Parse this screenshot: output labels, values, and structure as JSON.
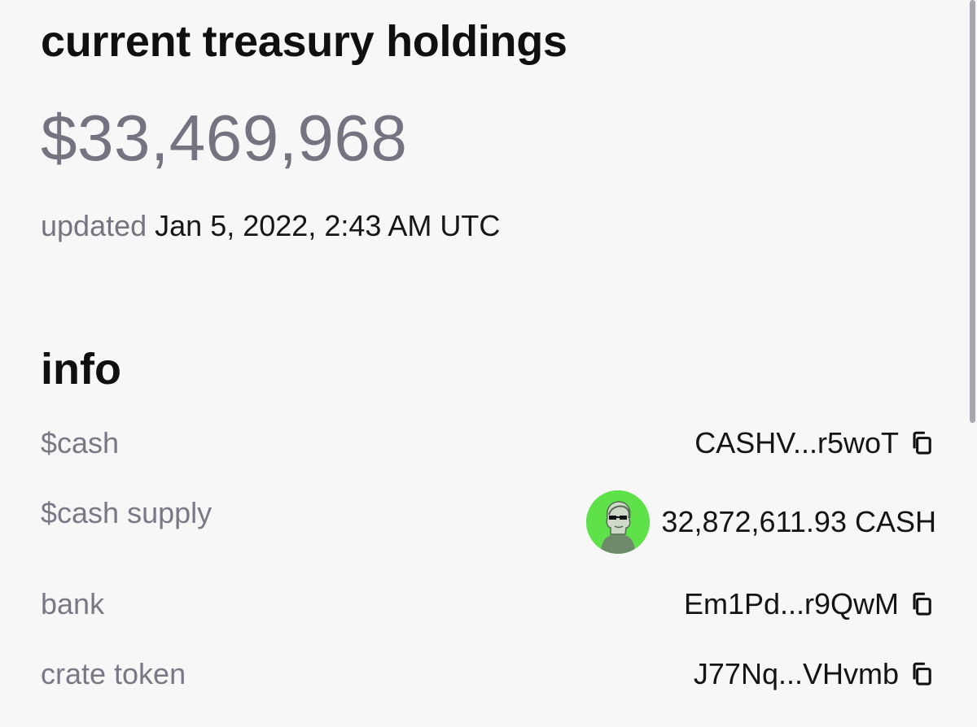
{
  "header": {
    "title": "current treasury holdings",
    "amount": "$33,469,968",
    "updated_label": "updated",
    "updated_value": "Jan 5, 2022, 2:43 AM UTC"
  },
  "info": {
    "title": "info",
    "rows": [
      {
        "label": "$cash",
        "value": "CASHV...r5woT",
        "icon": "copy-icon"
      },
      {
        "label": "$cash supply",
        "value": "32,872,611.93 CASH",
        "icon": "token-avatar"
      },
      {
        "label": "bank",
        "value": "Em1Pd...r9QwM",
        "icon": "copy-icon"
      },
      {
        "label": "crate token",
        "value": "J77Nq...VHvmb",
        "icon": "copy-icon"
      }
    ]
  },
  "colors": {
    "background": "#f7f7f8",
    "muted_text": "#76747f",
    "amount_text": "#75737f",
    "avatar_bg": "#5fe14a"
  }
}
